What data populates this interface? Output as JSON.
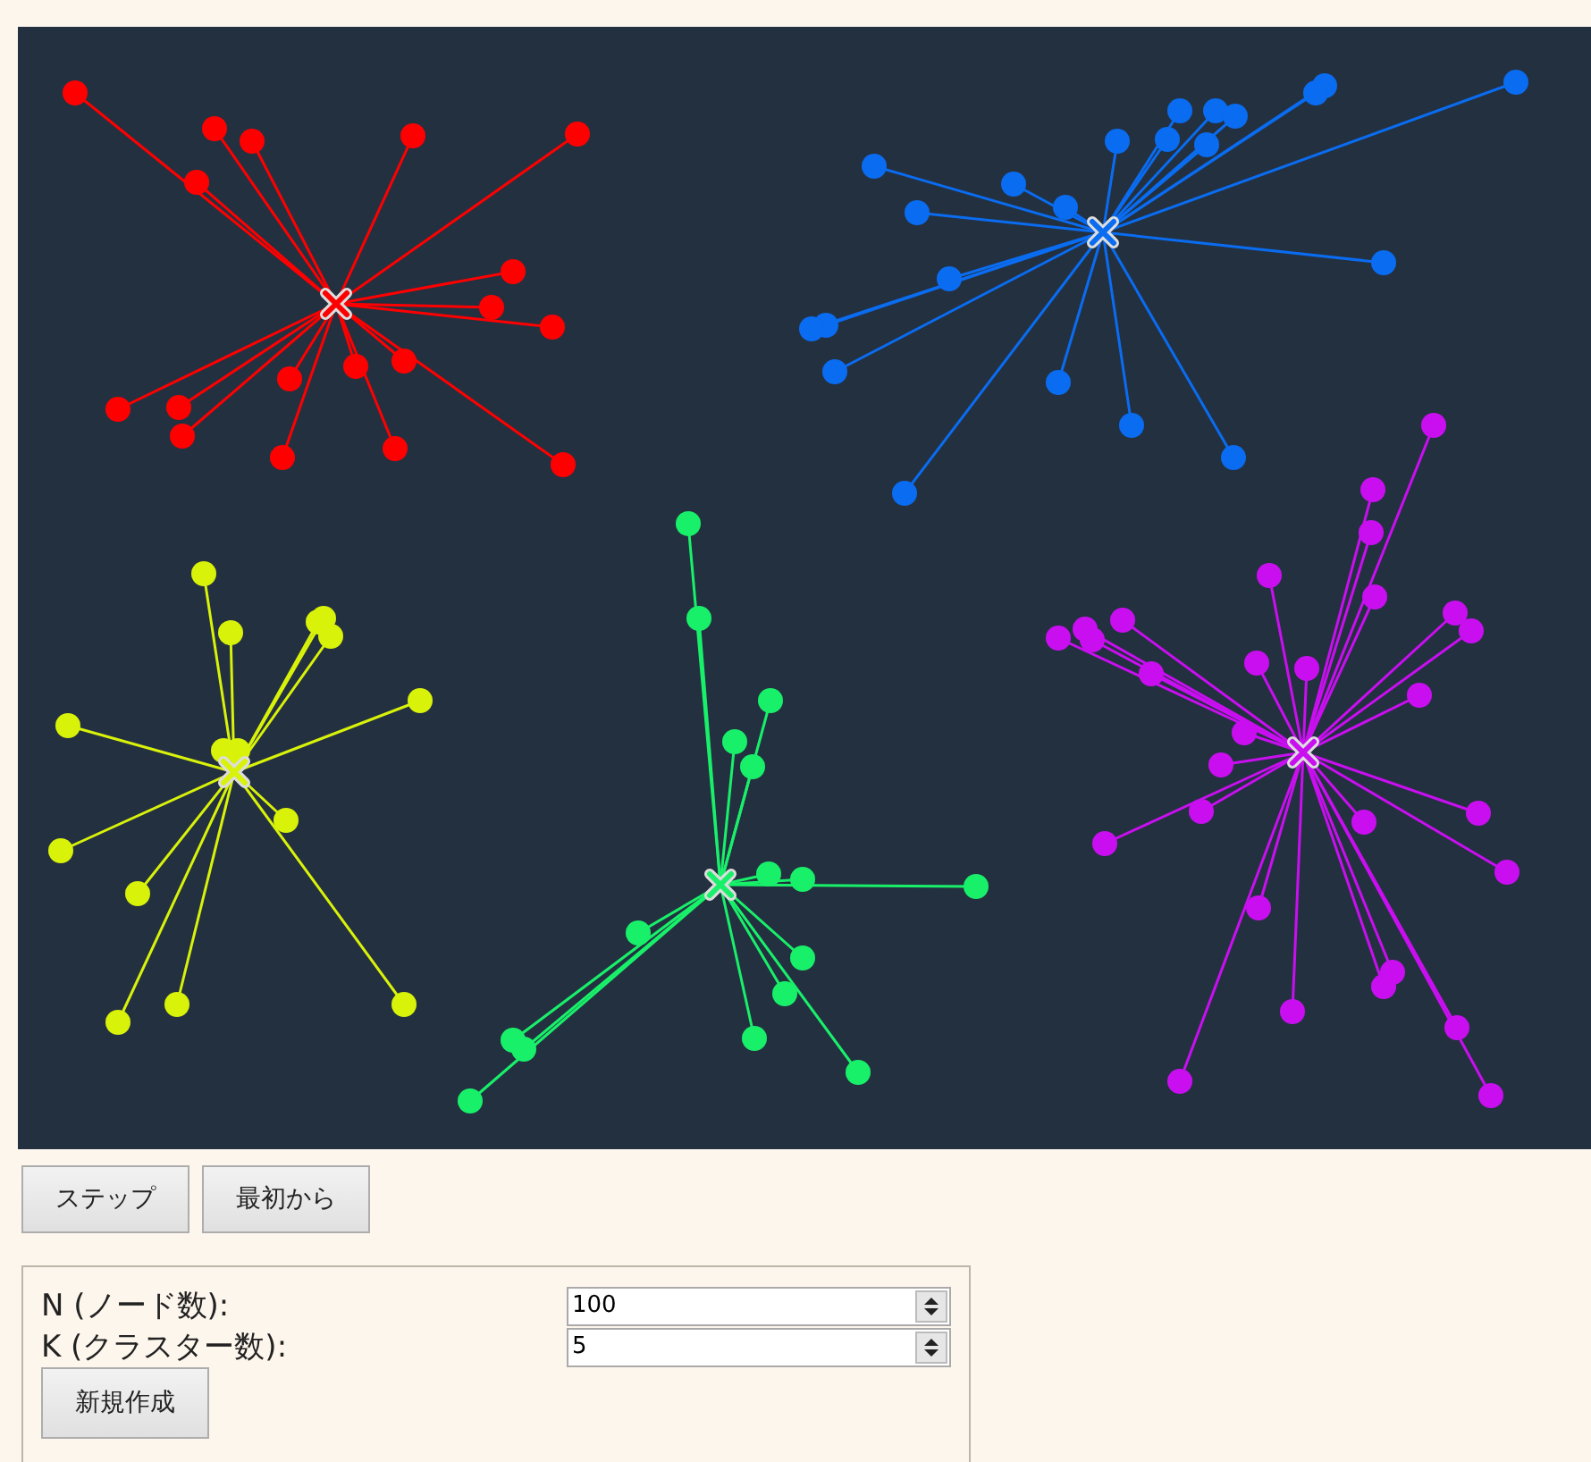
{
  "clusters": [
    {
      "color": "#ff0000"
    },
    {
      "color": "#0a6cf0"
    },
    {
      "color": "#d9f20a"
    },
    {
      "color": "#19f06a"
    },
    {
      "color": "#c90ff0"
    }
  ],
  "buttons": [
    {
      "label": "ステップ"
    },
    {
      "label": "最初から"
    }
  ],
  "settings": {
    "fields": [
      {
        "label": "N (ノード数):",
        "value": "100"
      },
      {
        "label": "K (クラスター数):",
        "value": "5"
      }
    ],
    "button": "新規作成"
  }
}
